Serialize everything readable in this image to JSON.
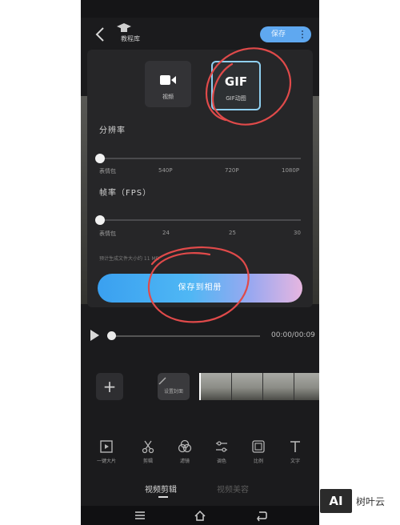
{
  "topbar": {
    "tutorial_label": "教程库",
    "export_label": "保存"
  },
  "export_panel": {
    "formats": [
      {
        "label": "视频",
        "icon": "video-camera-icon"
      },
      {
        "label": "GIF动图",
        "icon": "gif-icon",
        "badge": "GIF",
        "selected": true
      }
    ],
    "resolution": {
      "title": "分辨率",
      "ticks": [
        "表情包",
        "540P",
        "720P",
        "1080P"
      ],
      "selected_index": 0
    },
    "framerate": {
      "title": "帧率（FPS）",
      "ticks": [
        "表情包",
        "24",
        "25",
        "30"
      ],
      "selected_index": 0
    },
    "size_estimate": "预计生成文件大小约 11 MB",
    "save_button": "保存到相册",
    "accent_gradient": [
      "#3aa0f0",
      "#e6b6e0"
    ]
  },
  "playback": {
    "timecode": "00:00/00:09",
    "progress": 0
  },
  "timeline": {
    "add_label": "+",
    "cover_label": "设置封面"
  },
  "toolbar": [
    {
      "label": "一键大片",
      "icon": "film-icon"
    },
    {
      "label": "剪辑",
      "icon": "scissors-icon"
    },
    {
      "label": "滤镜",
      "icon": "filter-icon"
    },
    {
      "label": "调色",
      "icon": "adjust-icon"
    },
    {
      "label": "比例",
      "icon": "ratio-icon"
    },
    {
      "label": "文字",
      "icon": "text-icon"
    }
  ],
  "tabs": [
    {
      "label": "视频剪辑",
      "active": true
    },
    {
      "label": "视频美容",
      "active": false
    }
  ],
  "watermark": {
    "logo": "AI",
    "text": "树叶云"
  }
}
